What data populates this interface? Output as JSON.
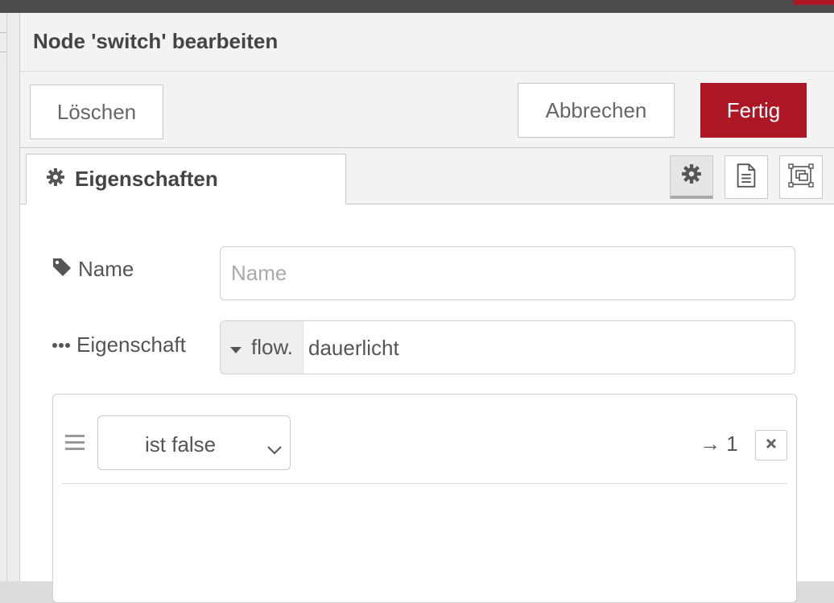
{
  "dialog": {
    "title": "Node 'switch' bearbeiten",
    "delete_label": "Löschen",
    "cancel_label": "Abbrechen",
    "done_label": "Fertig"
  },
  "tabs": {
    "properties_label": "Eigenschaften",
    "icons": [
      "gear-icon",
      "document-icon",
      "appearance-icon"
    ]
  },
  "form": {
    "name_label": "Name",
    "name_placeholder": "Name",
    "name_value": "",
    "property_label": "Eigenschaft",
    "property_type": "flow.",
    "property_value": "dauerlicht"
  },
  "rules": [
    {
      "operator": "ist false",
      "output": "→ 1"
    }
  ],
  "colors": {
    "accent": "#ad1625",
    "header_bg": "#f3f3f3",
    "border": "#c8c8c8"
  }
}
